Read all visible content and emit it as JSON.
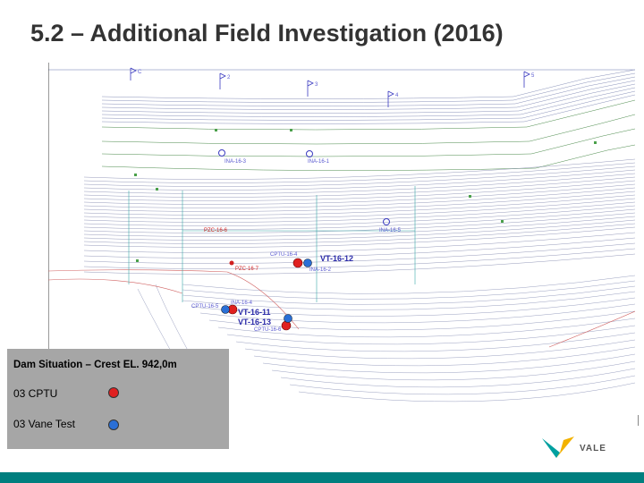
{
  "title": "5.2 – Additional Field Investigation (2016)",
  "legend": {
    "heading": "Dam Situation – Crest EL. 942,0m",
    "cptu_label": "03 CPTU",
    "vane_label": "03 Vane Test",
    "cptu_color": "#e02020",
    "vane_color": "#2a6fd6"
  },
  "map_labels": {
    "ina_16_3": "INA-16-3",
    "ina_16_1": "INA-16-1",
    "ina_16_5": "INA-16-5",
    "pzc_16_6": "PZC-16-6",
    "pzc_16_7": "PZC-16-7",
    "cptu_16_4": "CPTU-16-4",
    "vt_16_12": "VT-16-12",
    "ina_16_2": "INA-16-2",
    "ina_16_4": "INA-16-4",
    "cptu_16_5": "CPTU-16-5",
    "vt_16_11": "VT-16-11",
    "vt_16_13": "VT-16-13",
    "cptu_16_6": "CPTU-16-6"
  },
  "section_markers": [
    "C",
    "2",
    "3",
    "4",
    "5"
  ],
  "logo_text": "VALE",
  "footer_color": "#007f7f"
}
